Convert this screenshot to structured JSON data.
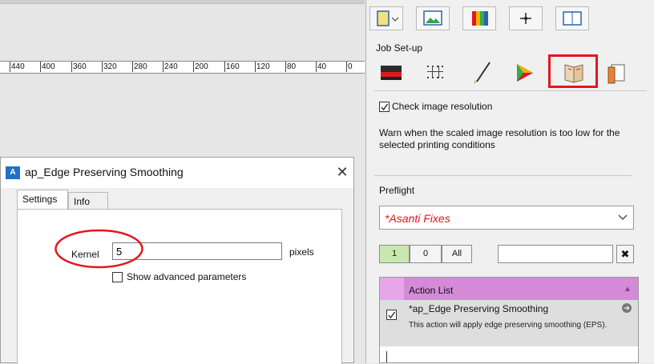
{
  "ruler": {
    "labels": [
      "80",
      "440",
      "400",
      "360",
      "320",
      "280",
      "240",
      "200",
      "160",
      "120",
      "80",
      "40",
      "0"
    ]
  },
  "dialog": {
    "app_icon": "A",
    "title": "ap_Edge Preserving Smoothing",
    "close_glyph": "✕",
    "tabs": [
      "Settings",
      "Info"
    ],
    "kernel_label": "Kernel",
    "kernel_value": "5",
    "kernel_unit": "pixels",
    "advanced_label": "Show advanced parameters",
    "advanced_checked": false
  },
  "panel": {
    "title": "Job Set-up",
    "check_resolution_label": "Check image resolution",
    "check_resolution_checked": true,
    "warning_text": "Warn when the scaled image resolution is too low for the selected printing conditions",
    "preflight_label": "Preflight",
    "preflight_value": "*Asanti Fixes",
    "filter_buttons": [
      "1",
      "0",
      "All"
    ],
    "filter_clear": "✖",
    "action_list": {
      "header": "Action List",
      "items": [
        {
          "checked": true,
          "name": "*ap_Edge Preserving Smoothing",
          "description": "This action will apply edge preserving smoothing (EPS)."
        }
      ]
    }
  },
  "colors": {
    "highlight_red": "#e2171e",
    "action_header": "#d58ad8",
    "filter_active": "#c9e8b0",
    "preflight_text": "#e3131b"
  },
  "icons": {
    "toolbar_row1": [
      "document-icon",
      "image-icon",
      "color-swatches-icon",
      "crosshair-icon",
      "window-icon"
    ],
    "toolbar_row2": [
      "printer-icon",
      "grid-icon",
      "brush-icon",
      "color-triangle-icon",
      "book-icon",
      "pages-icon"
    ]
  }
}
